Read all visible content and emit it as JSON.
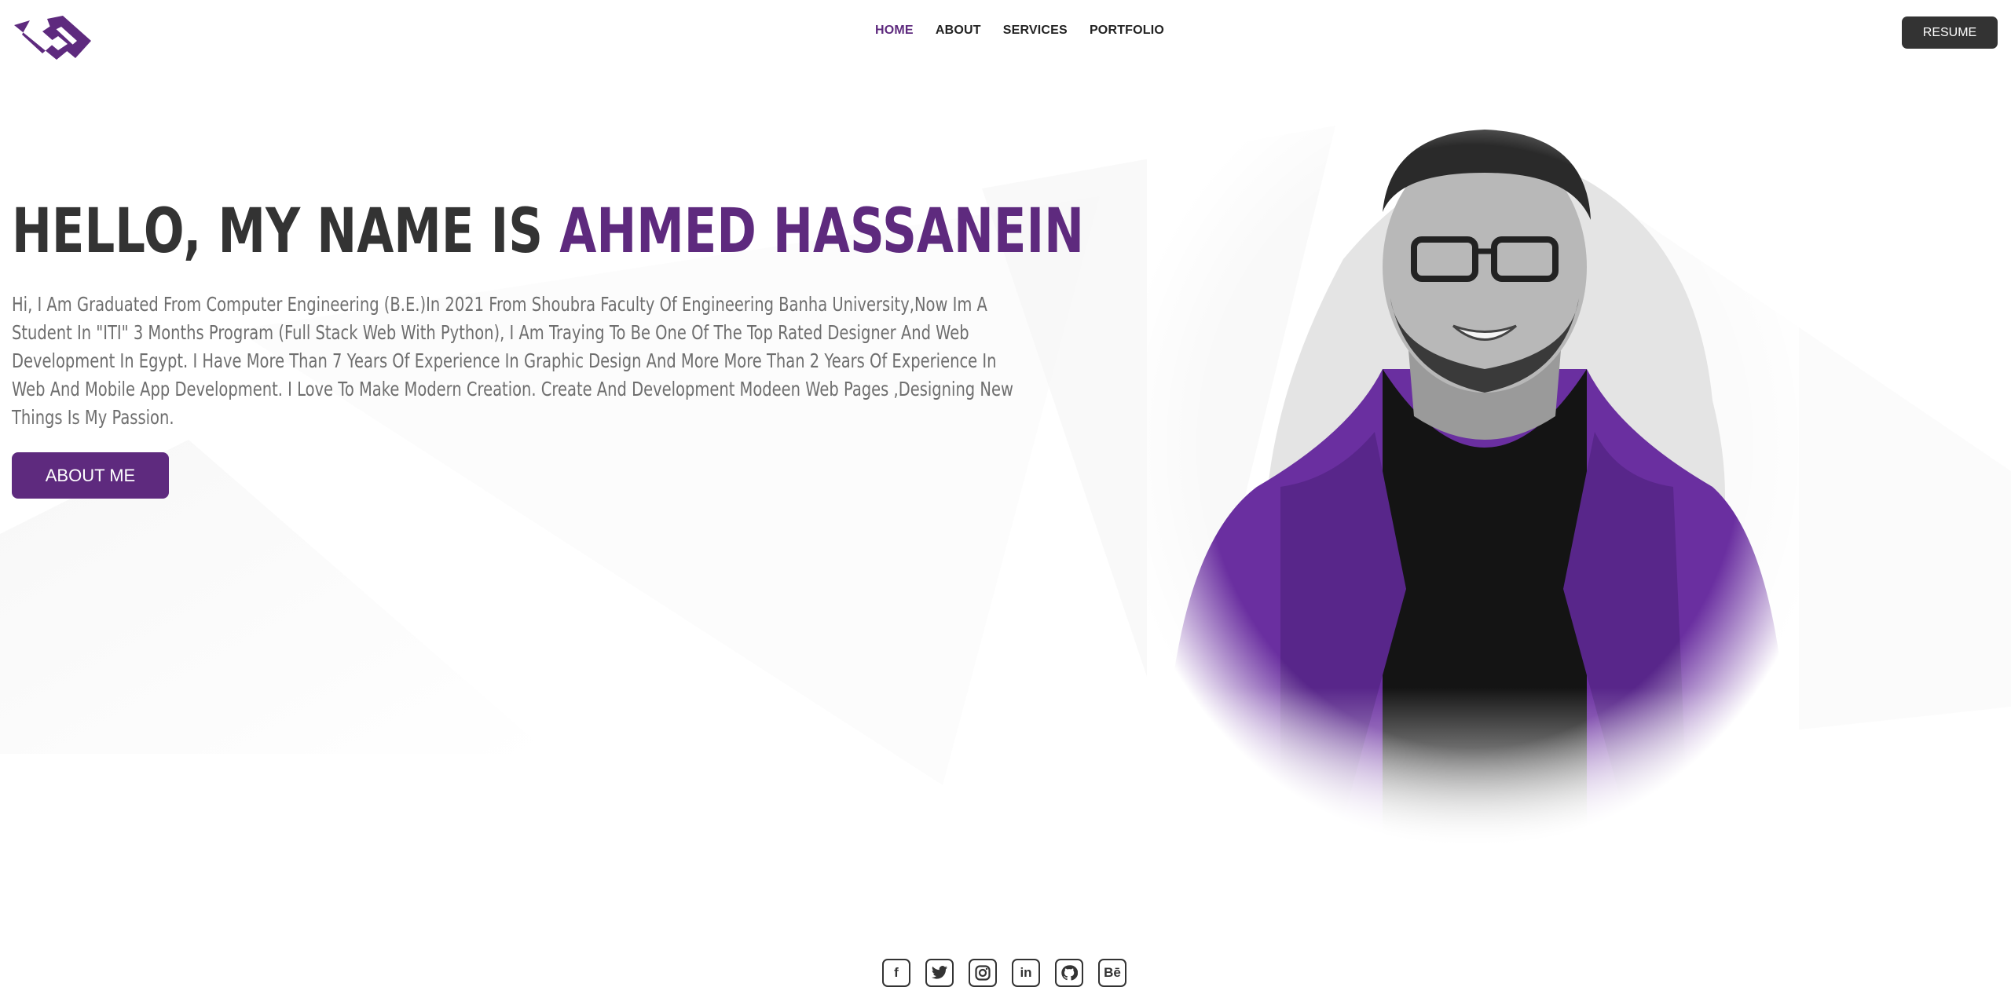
{
  "brand": {
    "logo_icon": "aa-monogram-logo",
    "accent": "#5e2a7e",
    "dark": "#333333"
  },
  "nav": {
    "items": [
      {
        "label": "HOME",
        "active": true
      },
      {
        "label": "ABOUT",
        "active": false
      },
      {
        "label": "SERVICES",
        "active": false
      },
      {
        "label": "PORTFOLIO",
        "active": false
      }
    ]
  },
  "header": {
    "resume_label": "RESUME"
  },
  "hero": {
    "title_prefix": "HELLO, MY NAME IS ",
    "title_name": "AHMED HASSANEIN",
    "description": "Hi, I Am Graduated From Computer Engineering (B.E.)In 2021 From Shoubra Faculty Of Engineering Banha University,Now Im A Student In \"ITI\" 3 Months Program (Full Stack Web With Python), I Am Traying To Be One Of The Top Rated Designer And Web Development In Egypt. I Have More Than 7 Years Of Experience In Graphic Design And More More Than 2 Years Of Experience In Web And Mobile App Development. I Love To Make Modern Creation. Create And Development Modeen Web Pages ,Designing New Things Is My Passion.",
    "cta_label": "ABOUT ME"
  },
  "social": [
    {
      "icon": "facebook-icon",
      "glyph": "f"
    },
    {
      "icon": "twitter-icon",
      "glyph": ""
    },
    {
      "icon": "instagram-icon",
      "glyph": ""
    },
    {
      "icon": "linkedin-icon",
      "glyph": "in"
    },
    {
      "icon": "github-icon",
      "glyph": ""
    },
    {
      "icon": "behance-icon",
      "glyph": "Bē"
    }
  ]
}
